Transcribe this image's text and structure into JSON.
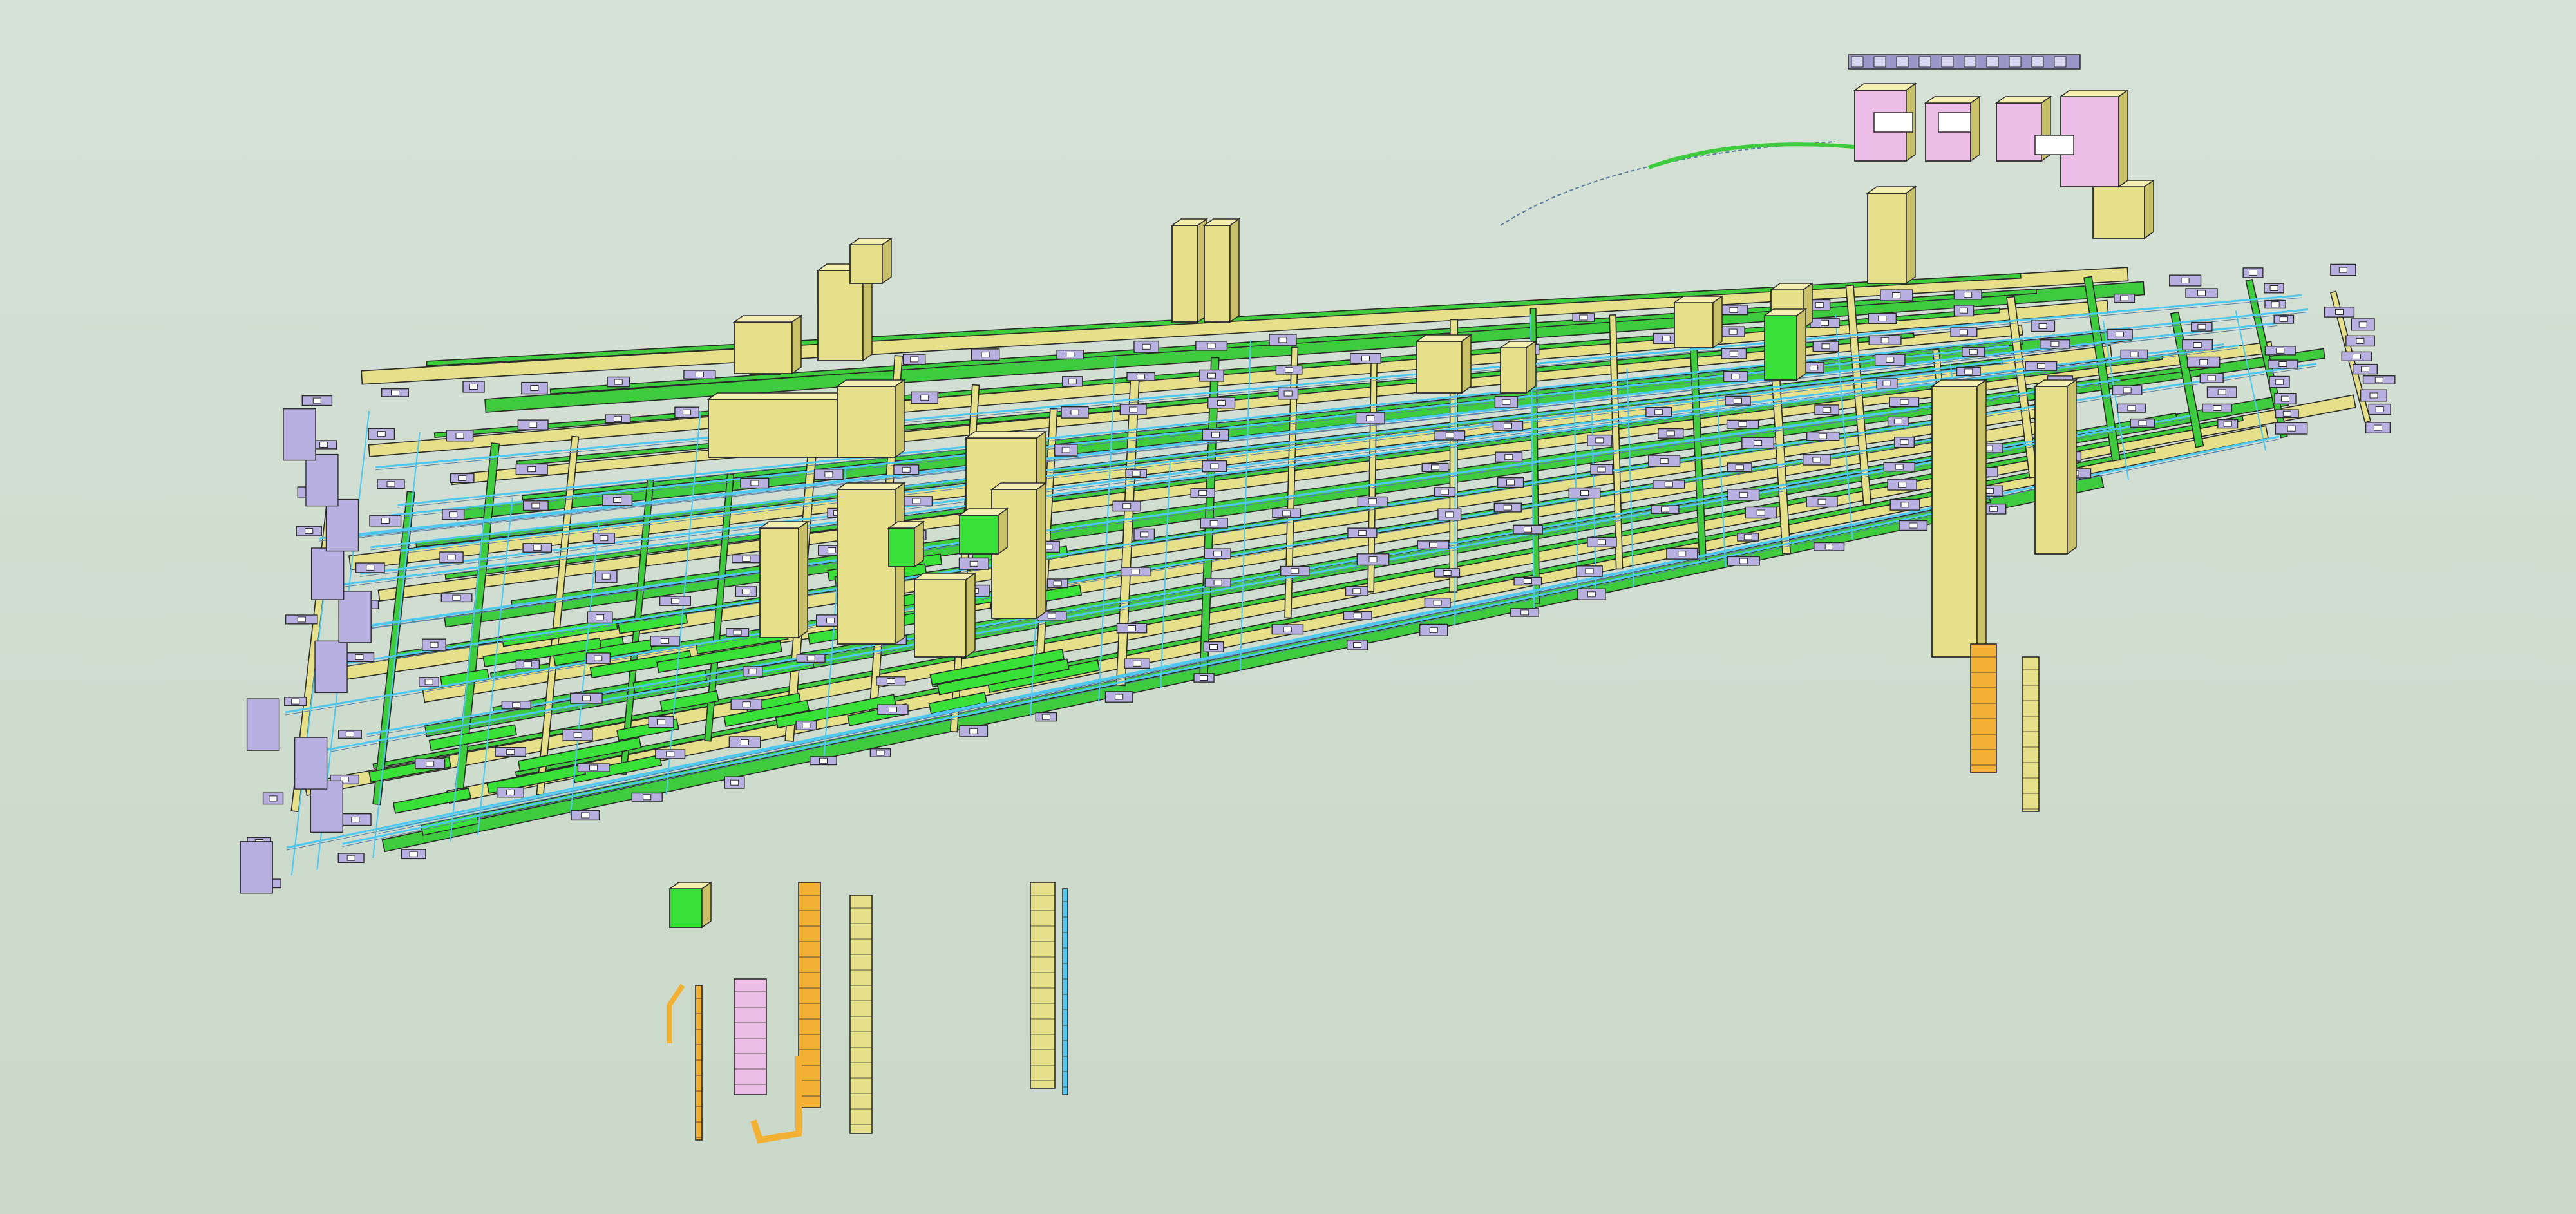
{
  "scene": {
    "subject": "mep-model-3d",
    "palette": {
      "background": "#d0ddd0",
      "duct_supply": "#e6e08a",
      "duct_return": "#3ecb3e",
      "pipe_water": "#4ec8f0",
      "riser_orange": "#f2b035",
      "diffuser": "#b8b0e0",
      "equipment_pink": "#ecbde6",
      "outline": "#2a2a2a"
    }
  }
}
